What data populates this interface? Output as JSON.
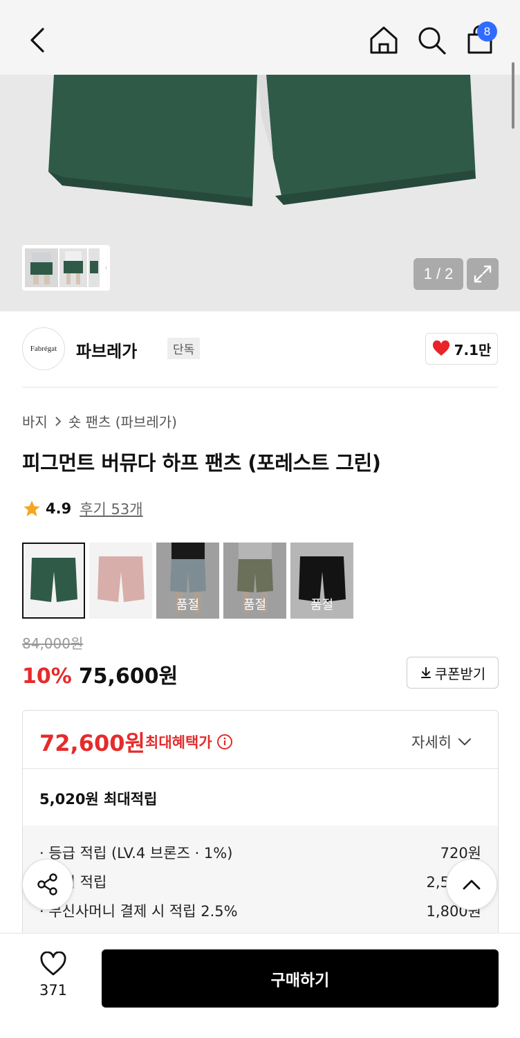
{
  "header": {
    "cart_count": "8"
  },
  "gallery": {
    "pager": "1 / 2"
  },
  "brand": {
    "logo_text": "Fabrégat",
    "name": "파브레가",
    "tag": "단독",
    "likes": "7.1만"
  },
  "product": {
    "breadcrumb": [
      "바지",
      "숏 팬츠 (파브레가)"
    ],
    "title": "피그먼트 버뮤다 하프 팬츠 (포레스트 그린)",
    "rating": "4.9",
    "review_link": "후기 53개",
    "options": [
      {
        "color": "#2f5a48",
        "sold_out": ""
      },
      {
        "color": "#d8aeaa",
        "sold_out": ""
      },
      {
        "color": "#a9bcc6",
        "sold_out": "품절"
      },
      {
        "color": "#8e9678",
        "sold_out": "품절"
      },
      {
        "color": "#1a1a1a",
        "sold_out": "품절"
      }
    ],
    "original_price": "84,000원",
    "discount": "10%",
    "sale_price": "75,600원",
    "coupon_label": "쿠폰받기"
  },
  "benefit": {
    "max_price": "72,600원",
    "max_label": "최대혜택가",
    "detail_label": "자세히",
    "max_points": "5,020원 최대적립",
    "rows": [
      {
        "label": "· 등급 적립 (LV.4 브론즈 · 1%)",
        "value": "720원"
      },
      {
        "label": "· 후기 적립",
        "value": "2,500원"
      },
      {
        "label": "· 무신사머니 결제 시 적립 2.5%",
        "value": "1,800원"
      }
    ]
  },
  "bottom": {
    "wish_count": "371",
    "buy_label": "구매하기"
  },
  "colors": {
    "accent_red": "#e52b2b",
    "badge_blue": "#2f6bff",
    "heart_red": "#e8242b"
  }
}
